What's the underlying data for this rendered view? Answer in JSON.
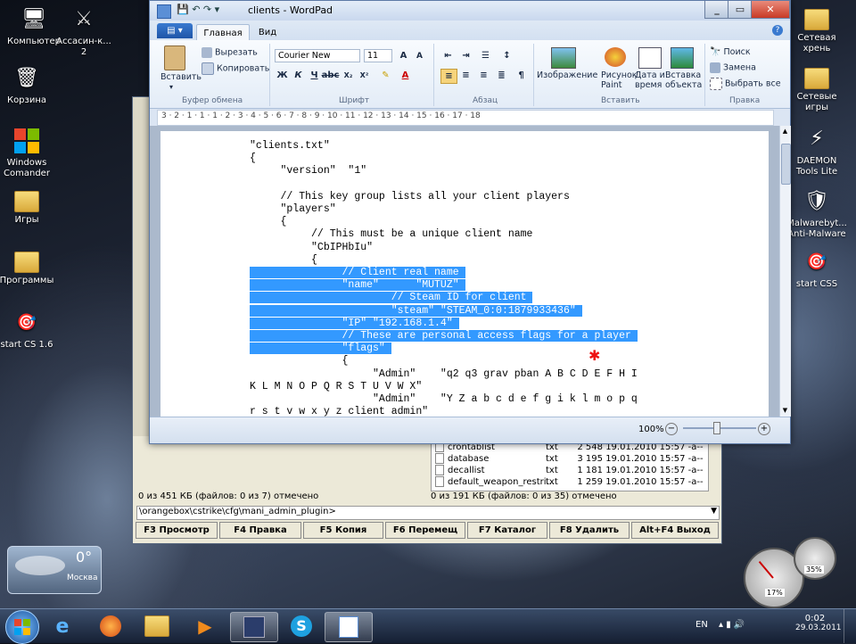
{
  "desktop_left": [
    {
      "label": "Компьютер",
      "icon": "computer-icon"
    },
    {
      "label": "Ассасин-к...\n2",
      "icon": "assassin-icon"
    },
    {
      "label": "Корзина",
      "icon": "recycle-bin-icon"
    },
    {
      "label": "Windows\nComander",
      "icon": "windows-logo-icon"
    },
    {
      "label": "Игры",
      "icon": "folder-icon"
    },
    {
      "label": "Программы",
      "icon": "folder-icon"
    },
    {
      "label": "start CS 1.6",
      "icon": "shortcut-icon"
    }
  ],
  "desktop_right": [
    {
      "label": "Сетевая\nхрень",
      "icon": "folder-icon"
    },
    {
      "label": "Сетевые\nигры",
      "icon": "folder-icon"
    },
    {
      "label": "DAEMON\nTools Lite",
      "icon": "daemon-tools-icon"
    },
    {
      "label": "Malwarebyt...\nAnti-Malware",
      "icon": "malwarebytes-icon"
    },
    {
      "label": "start CSS",
      "icon": "shortcut-icon"
    }
  ],
  "weather": {
    "temp": "0°",
    "city": "Москва"
  },
  "gauges": {
    "cpu": "17%",
    "mem": "35%"
  },
  "wordpad": {
    "title": "clients - WordPad",
    "tabs": {
      "home": "Главная",
      "view": "Вид"
    },
    "clipboard": {
      "paste": "Вставить",
      "cut": "Вырезать",
      "copy": "Копировать",
      "group": "Буфер обмена"
    },
    "font": {
      "family": "Courier New",
      "size": "11",
      "group": "Шрифт"
    },
    "paragraph": {
      "group": "Абзац"
    },
    "insert": {
      "image": "Изображение",
      "paint": "Рисунок\nPaint",
      "datetime": "Дата и\nвремя",
      "object": "Вставка\nобъекта",
      "group": "Вставить"
    },
    "edit": {
      "find": "Поиск",
      "replace": "Замена",
      "select_all": "Выбрать все",
      "group": "Правка"
    },
    "ruler": "3 · 2 · 1 · 1 · 1 · 2 · 3 · 4 · 5 · 6 · 7 · 8 · 9 · 10 · 11 · 12 · 13 · 14 · 15 · 16 · 17 · 18",
    "doc": {
      "before": "\"clients.txt\"\n{\n     \"version\"  \"1\"\n\n     // This key group lists all your client players\n     \"players\"\n     {\n          // This must be a unique client name\n          \"CbIPHbIu\"\n          {\n",
      "selected": [
        "               // Client real name ",
        "               \"name\"      \"MUTUZ\" ",
        "                       // Steam ID for client ",
        "                       \"steam\" \"STEAM_0:0:1879933436\" ",
        "               \"IP\" \"192.168.1.4\" ",
        "               // These are personal access flags for a player ",
        "               \"flags\" "
      ],
      "after": "               {\n                    \"Admin\"    \"q2 q3 grav pban A B C D E F H I\nK L M N O P Q R S T U V W X\"\n                    \"Admin\"    \"Y Z a b c d e f g i k l m o p q\nr s t v w x y z client admin\""
    },
    "zoom": "100%"
  },
  "totalcmd": {
    "files": [
      {
        "name": "crontablist",
        "ext": "txt",
        "size": "2 548",
        "date": "19.01.2010 15:57",
        "attr": "-a--"
      },
      {
        "name": "database",
        "ext": "txt",
        "size": "3 195",
        "date": "19.01.2010 15:57",
        "attr": "-a--"
      },
      {
        "name": "decallist",
        "ext": "txt",
        "size": "1 181",
        "date": "19.01.2010 15:57",
        "attr": "-a--"
      },
      {
        "name": "default_weapon_restri...",
        "ext": "txt",
        "size": "1 259",
        "date": "19.01.2010 15:57",
        "attr": "-a--"
      }
    ],
    "status_left": "0 из 451 КБ (файлов: 0 из 7) отмечено",
    "status_right": "0 из 191 КБ (файлов: 0 из 35) отмечено",
    "path": "\\orangebox\\cstrike\\cfg\\mani_admin_plugin>",
    "fkeys": [
      "F3 Просмотр",
      "F4 Правка",
      "F5 Копия",
      "F6 Перемещ",
      "F7 Каталог",
      "F8 Удалить",
      "Alt+F4 Выход"
    ]
  },
  "tray": {
    "lang": "EN",
    "time": "0:02",
    "date": "29.03.2011"
  }
}
